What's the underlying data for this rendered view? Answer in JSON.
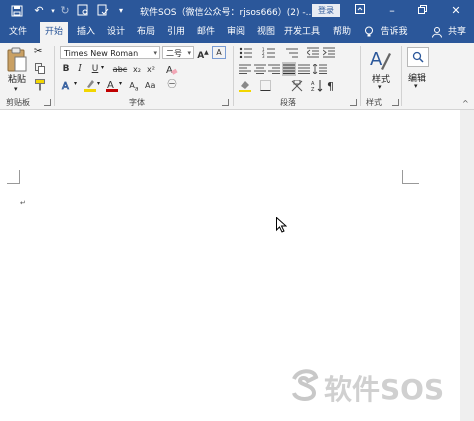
{
  "titlebar": {
    "title": "软件SOS（微信公众号：rjsos666）(2) -...",
    "login_label": "登录",
    "controls": [
      "minimize-icon",
      "restore-icon",
      "close-icon"
    ]
  },
  "tabs": [
    "文件",
    "开始",
    "插入",
    "设计",
    "布局",
    "引用",
    "邮件",
    "审阅",
    "视图",
    "开发工具",
    "帮助"
  ],
  "active_tab": "开始",
  "tell_me": "告诉我",
  "share": "共享",
  "ribbon": {
    "clipboard": {
      "paste_label": "粘贴",
      "group_label": "剪贴板"
    },
    "font": {
      "font_name": "Times New Roman",
      "font_size": "二号",
      "group_label": "字体",
      "bold": "B",
      "italic": "I",
      "underline": "U",
      "strike": "abc",
      "subscript": "x₂",
      "superscript": "x²",
      "grow": "A",
      "font_color": "A"
    },
    "paragraph": {
      "group_label": "段落"
    },
    "styles": {
      "label": "样式",
      "group_label": "样式"
    },
    "editing": {
      "label": "编辑"
    }
  },
  "document": {
    "paragraph_mark": "↵"
  },
  "watermark": {
    "text": "软件SOS"
  },
  "colors": {
    "accent": "#2b579a",
    "ribbon_bg": "#f3f3f3",
    "highlight": "#f2d600",
    "font_red": "#c00000"
  }
}
